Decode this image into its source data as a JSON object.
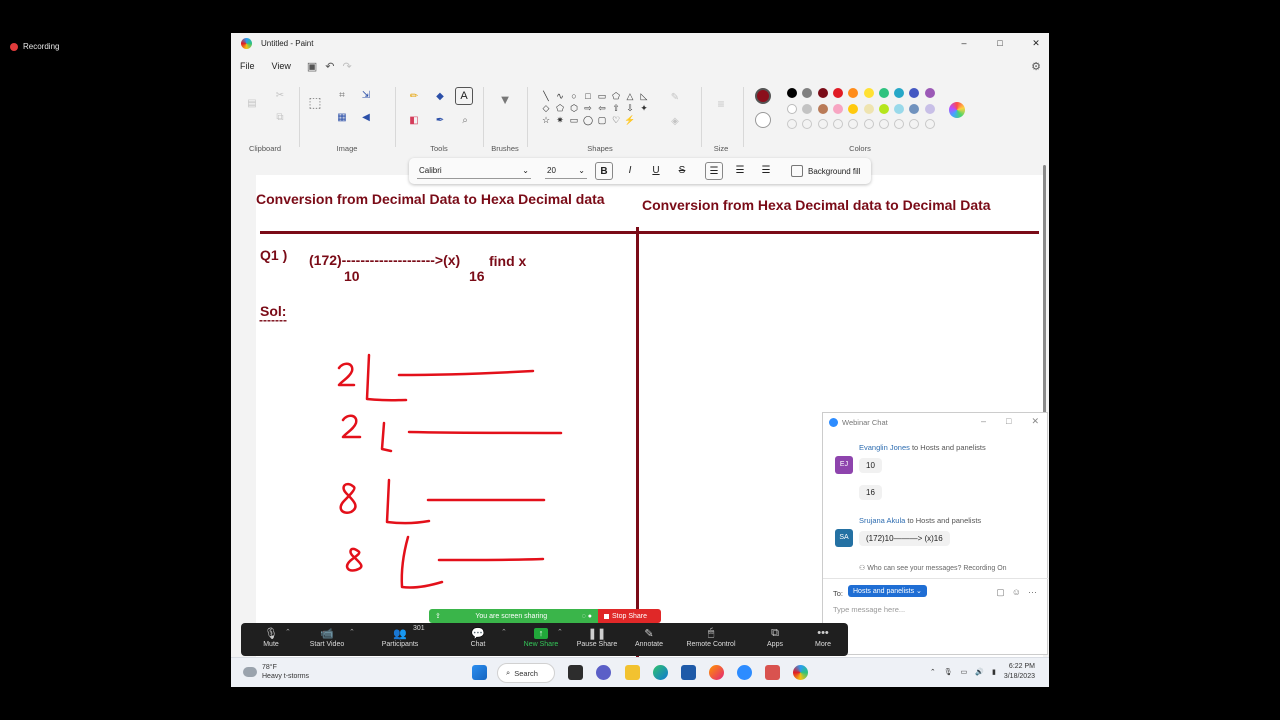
{
  "recording": {
    "label": "Recording"
  },
  "window": {
    "title": "Untitled - Paint",
    "minimize": "–",
    "maximize": "□",
    "close": "✕"
  },
  "menu": {
    "file": "File",
    "view": "View"
  },
  "ribbon": {
    "groups": {
      "clipboard": "Clipboard",
      "image": "Image",
      "tools": "Tools",
      "brushes": "Brushes",
      "shapes": "Shapes",
      "size": "Size",
      "colors": "Colors"
    },
    "text_tool": "A",
    "shape_glyphs": [
      "╲",
      "∿",
      "○",
      "□",
      "▭",
      "⬠",
      "△",
      "◺",
      "",
      "◇",
      "⬠",
      "⬡",
      "⇨",
      "⇦",
      "⇧",
      "⇩",
      "✦",
      "",
      "☆",
      "✷",
      "▭",
      "◯",
      "▢",
      "♡",
      "⚡",
      "",
      ""
    ]
  },
  "palette": {
    "primary": "#8b0f1c",
    "secondary": "#ffffff",
    "row1": [
      "#000000",
      "#7f7f7f",
      "#7a0b17",
      "#e01b24",
      "#ff8c1a",
      "#ffe133",
      "#2ec27e",
      "#26a7c7",
      "#4458c2",
      "#9b59b6"
    ],
    "row2": [
      "#ffffff",
      "#c3c3c3",
      "#b97a57",
      "#f7a5c2",
      "#ffc90e",
      "#efe4b0",
      "#b5e61d",
      "#99d9ea",
      "#7092be",
      "#c8bfe7"
    ]
  },
  "format_bar": {
    "font": "Calibri",
    "size": "20",
    "bold": "B",
    "italic": "I",
    "underline": "U",
    "strike": "S",
    "background_fill": "Background fill"
  },
  "board": {
    "left_heading": "Conversion from Decimal Data to Hexa Decimal data",
    "right_heading": "Conversion from Hexa Decimal data to Decimal Data",
    "q1_label": "Q1 )",
    "q1_expr": "(172)-------------------->(x)",
    "q1_base_from": "10",
    "q1_base_to": "16",
    "q1_find": "find x",
    "sol_label": "Sol:",
    "sol_underline": "-------"
  },
  "chat": {
    "title": "Webinar Chat",
    "messages": [
      {
        "sender": "Evanglin Jones",
        "to": "to Hosts and panelists",
        "initials": "EJ",
        "avatar_color": "#8e44ad",
        "lines": [
          "10",
          "16"
        ]
      },
      {
        "sender": "Srujana Akula",
        "to": "to Hosts and panelists",
        "initials": "SA",
        "avatar_color": "#2471a3",
        "lines": [
          "(172)10———> (x)16"
        ]
      }
    ],
    "who_can_see": "Who can see your messages? Recording On",
    "to_label": "To:",
    "recipient": "Hosts and panelists ⌄",
    "input_placeholder": "Type message here..."
  },
  "share": {
    "status": "You are screen sharing",
    "stop": "Stop Share"
  },
  "zoom_toolbar": {
    "participants_count": "301",
    "buttons": [
      {
        "name": "mute",
        "label": "Mute",
        "icon": "🎙"
      },
      {
        "name": "start-video",
        "label": "Start Video",
        "icon": "📹"
      },
      {
        "name": "participants",
        "label": "Participants",
        "icon": "👥"
      },
      {
        "name": "chat",
        "label": "Chat",
        "icon": "💬"
      },
      {
        "name": "new-share",
        "label": "New Share",
        "icon": "↑"
      },
      {
        "name": "pause-share",
        "label": "Pause Share",
        "icon": "❚❚"
      },
      {
        "name": "annotate",
        "label": "Annotate",
        "icon": "✎"
      },
      {
        "name": "remote-control",
        "label": "Remote Control",
        "icon": "🖱"
      },
      {
        "name": "apps",
        "label": "Apps",
        "icon": "⧉"
      },
      {
        "name": "more",
        "label": "More",
        "icon": "•••"
      }
    ]
  },
  "taskbar": {
    "temperature": "78°F",
    "weather": "Heavy t-storms",
    "search": "Search",
    "time": "6:22 PM",
    "date": "3/18/2023"
  }
}
